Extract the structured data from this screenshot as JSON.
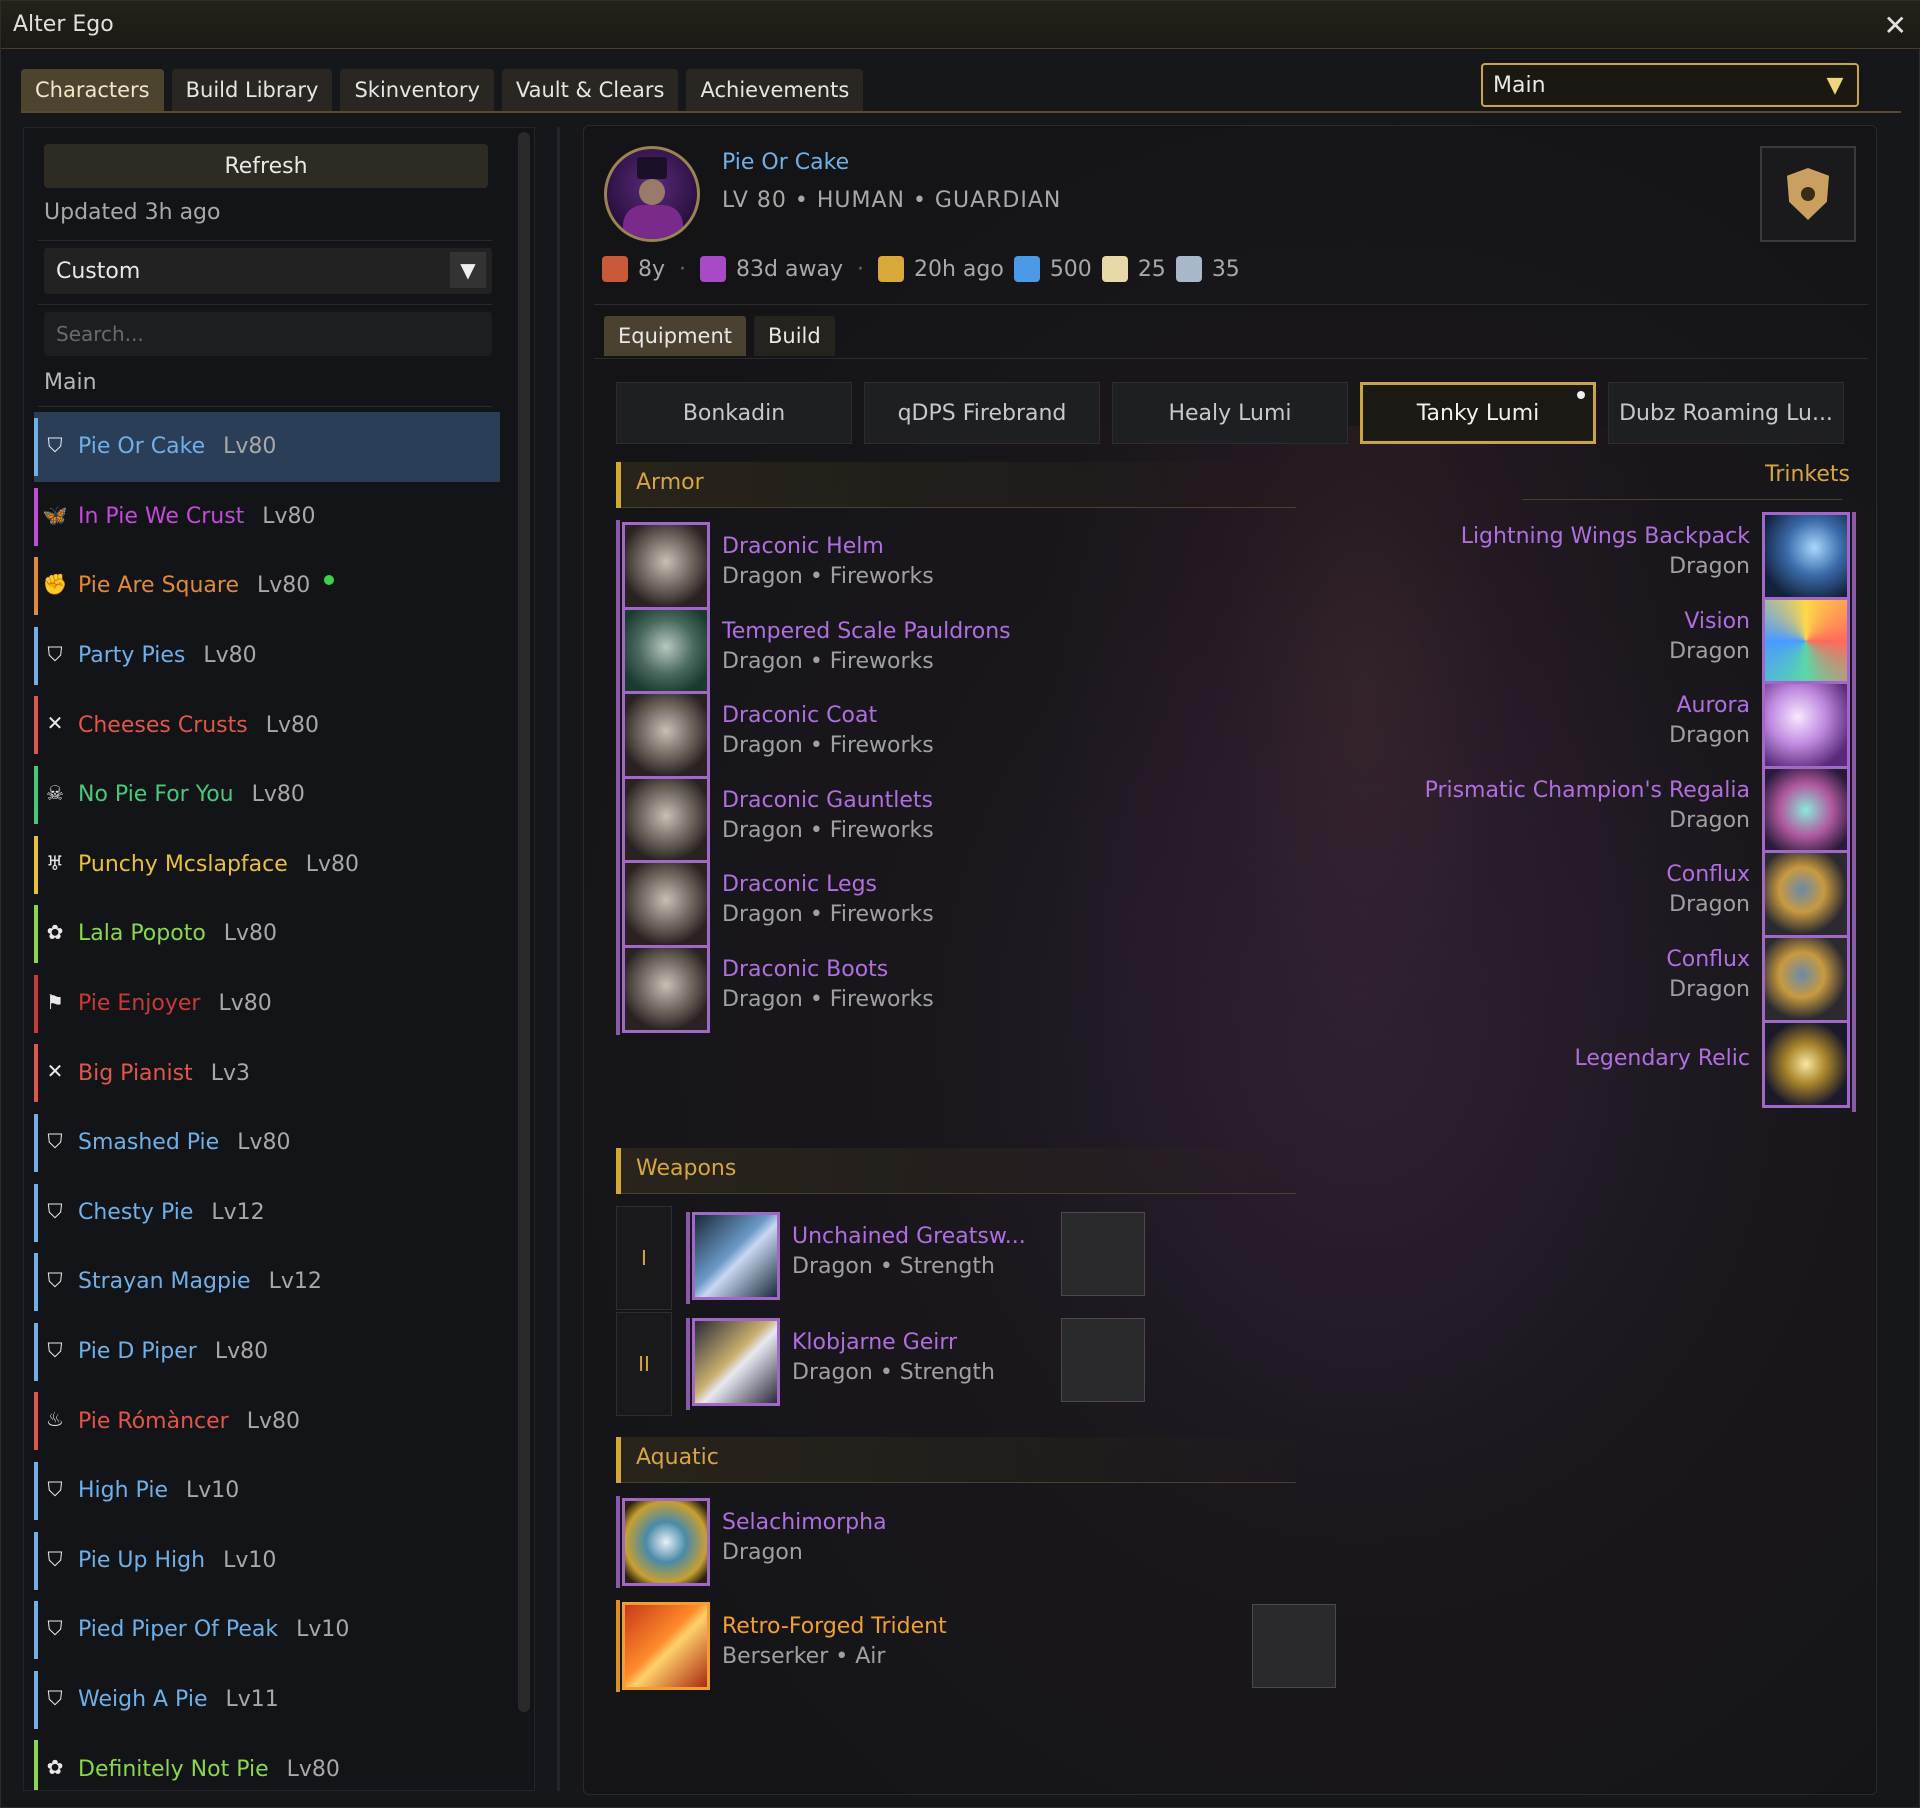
{
  "window": {
    "title": "Alter Ego",
    "close": "✕"
  },
  "tabs": [
    {
      "label": "Characters"
    },
    {
      "label": "Build Library"
    },
    {
      "label": "Skinventory"
    },
    {
      "label": "Vault & Clears"
    },
    {
      "label": "Achievements"
    }
  ],
  "account_select": {
    "value": "Main",
    "arrow": "▼"
  },
  "sidebar": {
    "refresh_label": "Refresh",
    "updated": "Updated 3h ago",
    "filter": {
      "value": "Custom",
      "arrow": "▼"
    },
    "search_placeholder": "Search...",
    "group_label": "Main",
    "characters": [
      {
        "name": "Pie Or Cake",
        "level": "Lv80",
        "color": "#6fb0e8",
        "icon": "guardian-icon",
        "glyph": "⛉",
        "active": true
      },
      {
        "name": "In Pie We Crust",
        "level": "Lv80",
        "color": "#c24bd8",
        "icon": "mesmer-icon",
        "glyph": "🦋"
      },
      {
        "name": "Pie Are Square",
        "level": "Lv80",
        "color": "#e08a3a",
        "icon": "engineer-icon",
        "glyph": "✊",
        "online": true
      },
      {
        "name": "Party Pies",
        "level": "Lv80",
        "color": "#6fb0e8",
        "icon": "guardian-icon",
        "glyph": "⛉"
      },
      {
        "name": "Cheeses Crusts",
        "level": "Lv80",
        "color": "#e0564a",
        "icon": "thief-icon",
        "glyph": "✕"
      },
      {
        "name": "No Pie For You",
        "level": "Lv80",
        "color": "#4ac87a",
        "icon": "necromancer-icon",
        "glyph": "☠"
      },
      {
        "name": "Punchy Mcslapface",
        "level": "Lv80",
        "color": "#e8c03a",
        "icon": "warrior-icon",
        "glyph": "♅"
      },
      {
        "name": "Lala Popoto",
        "level": "Lv80",
        "color": "#8ad84a",
        "icon": "ranger-icon",
        "glyph": "✿"
      },
      {
        "name": "Pie Enjoyer",
        "level": "Lv80",
        "color": "#c83a3a",
        "icon": "revenant-icon",
        "glyph": "⚑"
      },
      {
        "name": "Big Pianist",
        "level": "Lv3",
        "color": "#e0564a",
        "icon": "thief-icon",
        "glyph": "✕"
      },
      {
        "name": "Smashed Pie",
        "level": "Lv80",
        "color": "#6fb0e8",
        "icon": "guardian-icon",
        "glyph": "⛉"
      },
      {
        "name": "Chesty Pie",
        "level": "Lv12",
        "color": "#6fb0e8",
        "icon": "guardian-icon",
        "glyph": "⛉"
      },
      {
        "name": "Strayan Magpie",
        "level": "Lv12",
        "color": "#6fb0e8",
        "icon": "guardian-icon",
        "glyph": "⛉"
      },
      {
        "name": "Pie D Piper",
        "level": "Lv80",
        "color": "#6fb0e8",
        "icon": "guardian-icon",
        "glyph": "⛉"
      },
      {
        "name": "Pie Rómàncer",
        "level": "Lv80",
        "color": "#e0564a",
        "icon": "elementalist-icon",
        "glyph": "♨"
      },
      {
        "name": "High Pie",
        "level": "Lv10",
        "color": "#6fb0e8",
        "icon": "guardian-icon",
        "glyph": "⛉"
      },
      {
        "name": "Pie Up High",
        "level": "Lv10",
        "color": "#6fb0e8",
        "icon": "guardian-icon",
        "glyph": "⛉"
      },
      {
        "name": "Pied Piper Of Peak",
        "level": "Lv10",
        "color": "#6fb0e8",
        "icon": "guardian-icon",
        "glyph": "⛉"
      },
      {
        "name": "Weigh A Pie",
        "level": "Lv11",
        "color": "#6fb0e8",
        "icon": "guardian-icon",
        "glyph": "⛉"
      },
      {
        "name": "Definitely Not Pie",
        "level": "Lv80",
        "color": "#8ad84a",
        "icon": "ranger-icon",
        "glyph": "✿"
      }
    ]
  },
  "character": {
    "name": "Pie Or Cake",
    "meta": "LV 80  •  HUMAN  •  GUARDIAN",
    "stats": [
      {
        "icon": "birthday-icon",
        "text": "8y",
        "color": "#c85a3a"
      },
      {
        "icon": "away-icon",
        "text": "83d away",
        "color": "#a84ac8"
      },
      {
        "icon": "played-icon",
        "text": "20h ago",
        "color": "#d8a83a"
      },
      {
        "icon": "ap-icon",
        "text": "500",
        "color": "#4a9ae8"
      },
      {
        "icon": "mastery-icon",
        "text": "25",
        "color": "#e8d8a8"
      },
      {
        "icon": "wvw-icon",
        "text": "35",
        "color": "#a8b8c8"
      }
    ]
  },
  "sub_tabs": [
    {
      "label": "Equipment"
    },
    {
      "label": "Build"
    }
  ],
  "builds": [
    {
      "label": "Bonkadin"
    },
    {
      "label": "qDPS Firebrand"
    },
    {
      "label": "Healy Lumi"
    },
    {
      "label": "Tanky Lumi",
      "active": true
    },
    {
      "label": "Dubz Roaming Lu..."
    }
  ],
  "sections": {
    "armor": "Armor",
    "trinkets": "Trinkets",
    "weapons": "Weapons",
    "aquatic": "Aquatic"
  },
  "armor": [
    {
      "name": "Draconic Helm",
      "sub": "Dragon • Fireworks",
      "icon": "helm-icon"
    },
    {
      "name": "Tempered Scale Pauldrons",
      "sub": "Dragon • Fireworks",
      "icon": "pauldrons-icon"
    },
    {
      "name": "Draconic Coat",
      "sub": "Dragon • Fireworks",
      "icon": "coat-icon"
    },
    {
      "name": "Draconic Gauntlets",
      "sub": "Dragon • Fireworks",
      "icon": "gauntlets-icon"
    },
    {
      "name": "Draconic Legs",
      "sub": "Dragon • Fireworks",
      "icon": "legs-icon"
    },
    {
      "name": "Draconic Boots",
      "sub": "Dragon • Fireworks",
      "icon": "boots-icon"
    }
  ],
  "trinkets": [
    {
      "name": "Lightning Wings Backpack",
      "sub": "Dragon",
      "icon": "backpack-icon"
    },
    {
      "name": "Vision",
      "sub": "Dragon",
      "icon": "accessory-icon"
    },
    {
      "name": "Aurora",
      "sub": "Dragon",
      "icon": "accessory-icon"
    },
    {
      "name": "Prismatic Champion's Regalia",
      "sub": "Dragon",
      "icon": "amulet-icon"
    },
    {
      "name": "Conflux",
      "sub": "Dragon",
      "icon": "ring-icon"
    },
    {
      "name": "Conflux",
      "sub": "Dragon",
      "icon": "ring-icon"
    },
    {
      "name": "Legendary Relic",
      "sub": "",
      "icon": "relic-icon"
    }
  ],
  "weapons": [
    {
      "slot": "I",
      "name": "Unchained Greatsw...",
      "sub": "Dragon • Strength",
      "icon": "greatsword-icon"
    },
    {
      "slot": "II",
      "name": "Klobjarne Geirr",
      "sub": "Dragon • Strength",
      "icon": "spear-icon"
    }
  ],
  "aquatic": [
    {
      "name": "Selachimorpha",
      "sub": "Dragon",
      "icon": "breather-icon",
      "color": "#b06ee0"
    },
    {
      "name": "Retro-Forged Trident",
      "sub": "Berserker • Air",
      "icon": "trident-icon",
      "color": "#f0a030"
    }
  ]
}
